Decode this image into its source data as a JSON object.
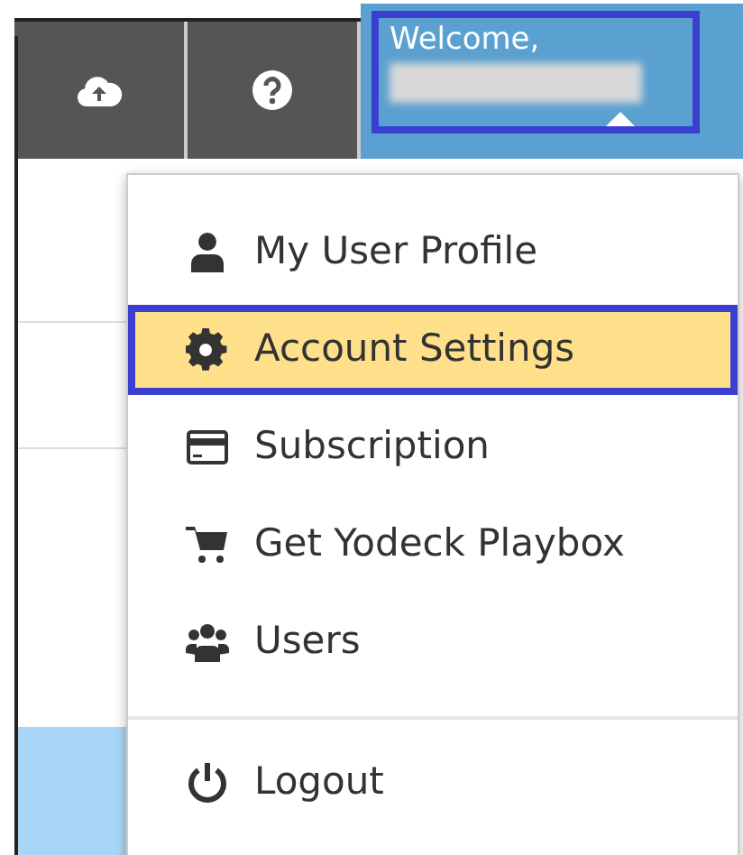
{
  "top_bar": {
    "user_menu": {
      "greeting": "Welcome,",
      "highlighted": true,
      "expanded": true
    }
  },
  "dropdown": {
    "items": [
      {
        "label": "My User Profile",
        "selected": false
      },
      {
        "label": "Account Settings",
        "selected": true
      },
      {
        "label": "Subscription",
        "selected": false
      },
      {
        "label": "Get Yodeck Playbox",
        "selected": false
      },
      {
        "label": "Users",
        "selected": false
      }
    ],
    "footer_items": [
      {
        "label": "Logout",
        "selected": false
      }
    ]
  }
}
